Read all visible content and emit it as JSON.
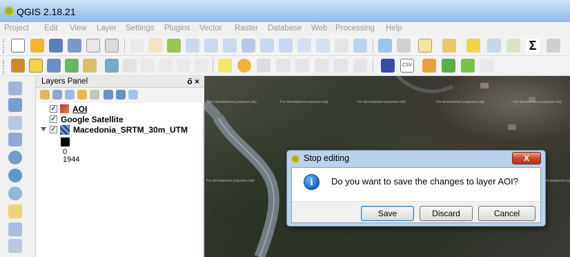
{
  "window": {
    "title": "QGIS 2.18.21"
  },
  "menubar": {
    "items": [
      "Project",
      "Edit",
      "View",
      "Layer",
      "Settings",
      "Plugins",
      "Vector",
      "Raster",
      "Database",
      "Web",
      "Processing",
      "Help"
    ]
  },
  "layers_panel": {
    "title": "Layers Panel",
    "controls": "ő ×",
    "layers": [
      {
        "name": "AOI",
        "checked": true
      },
      {
        "name": "Google Satellite",
        "checked": true
      },
      {
        "name": "Macedonia_SRTM_30m_UTM",
        "checked": true,
        "legend_min": "0",
        "legend_max": "1944"
      }
    ]
  },
  "map": {
    "watermark": "For development purposes only"
  },
  "dialog": {
    "title": "Stop editing",
    "close_label": "X",
    "message": "Do you want to save the changes to layer AOI?",
    "buttons": {
      "save": "Save",
      "discard": "Discard",
      "cancel": "Cancel"
    }
  },
  "colors": {
    "accent": "#1767c9",
    "close": "#c74a2f",
    "titlebar": "#a7c8ec"
  }
}
